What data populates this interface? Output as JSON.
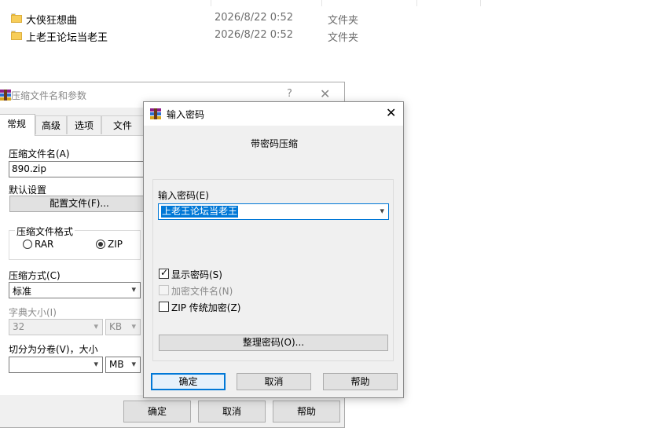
{
  "explorer": {
    "files": [
      {
        "name": "大侠狂想曲",
        "date": "2026/8/22 0:52",
        "type": "文件夹"
      },
      {
        "name": "上老王论坛当老王",
        "date": "2026/8/22 0:52",
        "type": "文件夹"
      }
    ]
  },
  "main_dialog": {
    "title": "压缩文件名和参数",
    "help_glyph": "?",
    "close_glyph": "✕",
    "tabs": [
      {
        "label": "常规",
        "active": true
      },
      {
        "label": "高级"
      },
      {
        "label": "选项"
      },
      {
        "label": "文件"
      }
    ],
    "archive_name_label": "压缩文件名(A)",
    "archive_name_value": "890.zip",
    "defaults_label": "默认设置",
    "profiles_button": "配置文件(F)...",
    "format_group_label": "压缩文件格式",
    "format_options": [
      {
        "label": "RAR",
        "selected": false
      },
      {
        "label": "ZIP",
        "selected": true
      }
    ],
    "method_label": "压缩方式(C)",
    "method_value": "标准",
    "dict_label": "字典大小(I)",
    "dict_value": "32",
    "dict_unit": "KB",
    "split_label": "切分为分卷(V)，大小",
    "split_value": "",
    "split_unit": "MB",
    "ok_button": "确定",
    "cancel_button": "取消",
    "help_button": "帮助"
  },
  "password_dialog": {
    "title": "输入密码",
    "close_glyph": "✕",
    "subtitle": "带密码压缩",
    "input_label": "输入密码(E)",
    "input_value": "上老王论坛当老王",
    "show_password": {
      "label": "显示密码(S)",
      "checked": true
    },
    "encrypt_names": {
      "label": "加密文件名(N)",
      "checked": false,
      "disabled": true
    },
    "zip_legacy": {
      "label": "ZIP 传统加密(Z)",
      "checked": false
    },
    "organize_button": "整理密码(O)...",
    "ok_button": "确定",
    "cancel_button": "取消",
    "help_button": "帮助"
  },
  "icons": {
    "folder": "folder-icon",
    "winrar": "winrar-icon",
    "dropdown": "▾",
    "check": "✓"
  },
  "colors": {
    "accent": "#0078d7",
    "folder": "#f7cd59"
  }
}
